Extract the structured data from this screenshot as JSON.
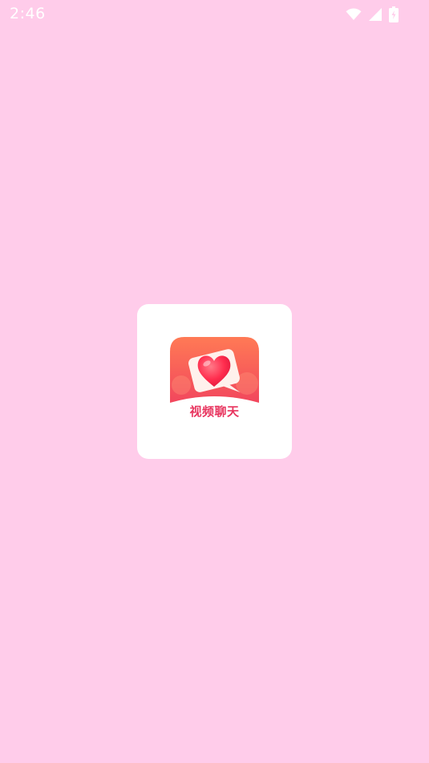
{
  "status_bar": {
    "time": "2:46",
    "icons": [
      "wifi-icon",
      "cellular-signal-icon",
      "battery-charging-icon"
    ]
  },
  "splash": {
    "logo_label": "视频聊天",
    "colors": {
      "background": "#FFCCEA",
      "card": "#FFFFFF",
      "logo_gradient_top": "#FF7A55",
      "logo_gradient_bottom": "#F0405E",
      "heart": "#FF2D4E",
      "label": "#E8345E"
    }
  }
}
